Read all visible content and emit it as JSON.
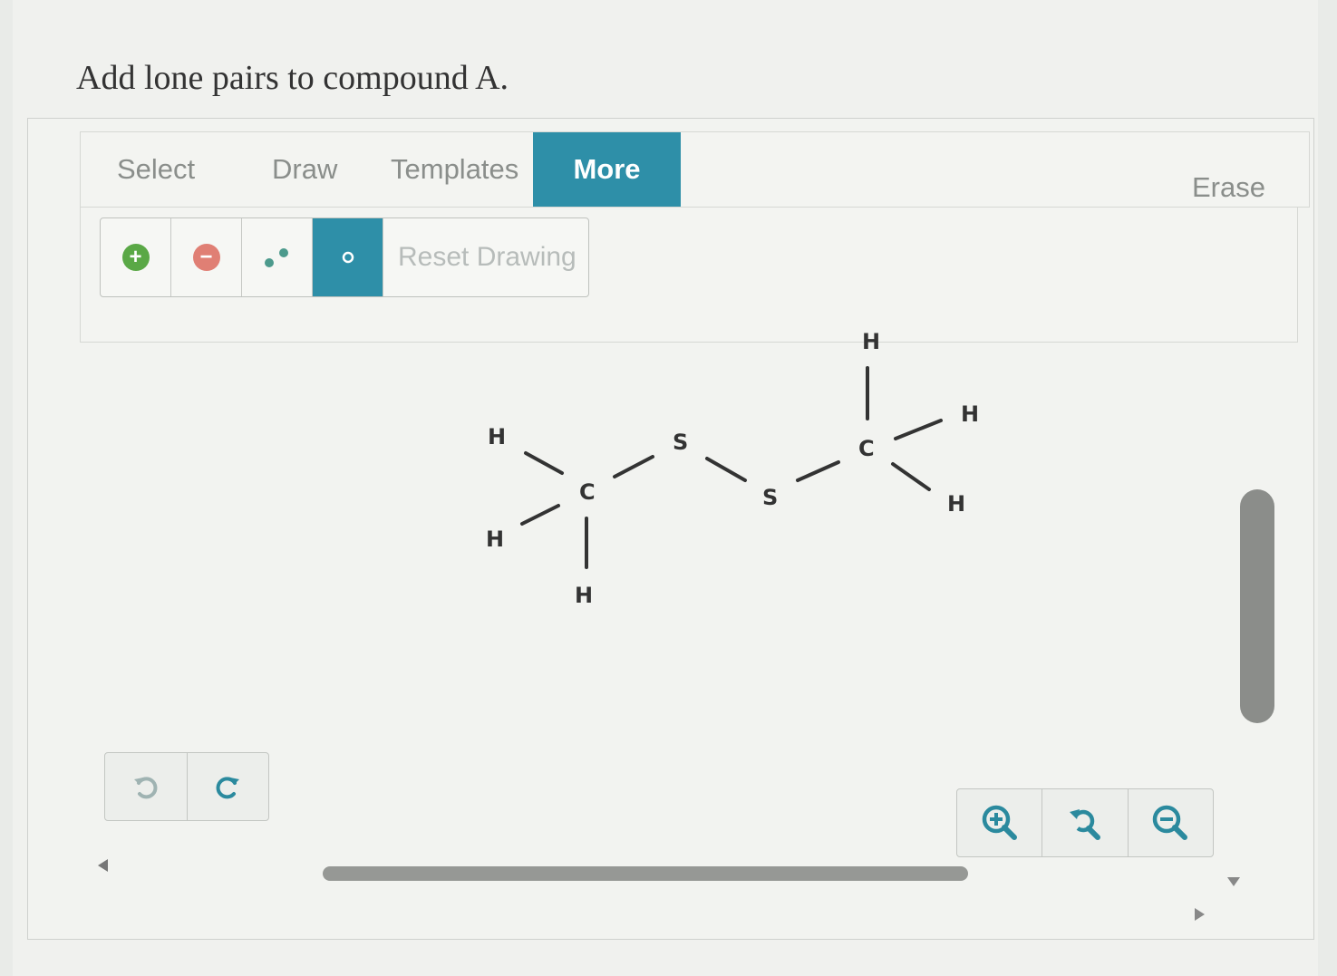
{
  "question": "Add lone pairs to compound A.",
  "tabs": [
    {
      "label": "Select",
      "active": false
    },
    {
      "label": "Draw",
      "active": false
    },
    {
      "label": "Templates",
      "active": false
    },
    {
      "label": "More",
      "active": true
    }
  ],
  "erase_label": "Erase",
  "tools": {
    "add_charge_icon": "plus-circle-icon",
    "remove_charge_icon": "minus-circle-icon",
    "radical_icon": "radical-dots-icon",
    "lone_pair_icon": "lone-pair-icon",
    "reset_label": "Reset Drawing",
    "active_tool": "lone-pair"
  },
  "molecule": {
    "atoms": [
      {
        "id": "H1",
        "symbol": "H"
      },
      {
        "id": "H2",
        "symbol": "H"
      },
      {
        "id": "C1",
        "symbol": "C"
      },
      {
        "id": "H3",
        "symbol": "H"
      },
      {
        "id": "S1",
        "symbol": "S"
      },
      {
        "id": "S2",
        "symbol": "S"
      },
      {
        "id": "C2",
        "symbol": "C"
      },
      {
        "id": "H4",
        "symbol": "H"
      },
      {
        "id": "H5",
        "symbol": "H"
      },
      {
        "id": "H6",
        "symbol": "H"
      }
    ],
    "bonds": [
      [
        "C1",
        "H1"
      ],
      [
        "C1",
        "H2"
      ],
      [
        "C1",
        "H3"
      ],
      [
        "C1",
        "S1"
      ],
      [
        "S1",
        "S2"
      ],
      [
        "S2",
        "C2"
      ],
      [
        "C2",
        "H4"
      ],
      [
        "C2",
        "H5"
      ],
      [
        "C2",
        "H6"
      ]
    ]
  },
  "colors": {
    "accent": "#2e8fa8",
    "plus_green": "#5aa846",
    "minus_red": "#e07f74",
    "zoom_teal": "#2b8a9e"
  }
}
